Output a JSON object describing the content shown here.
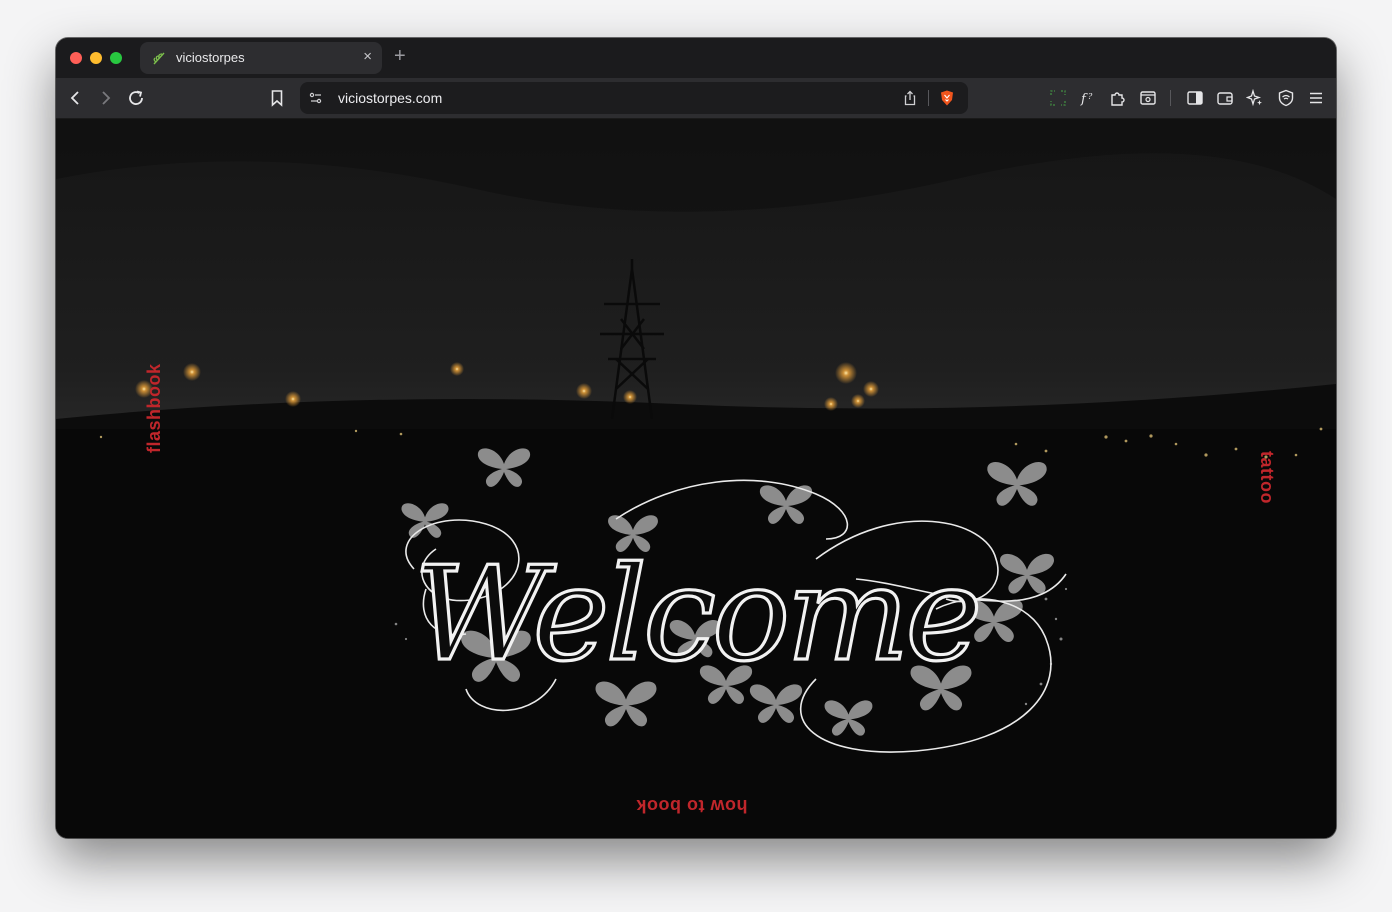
{
  "browser": {
    "tab": {
      "title": "viciostorpes",
      "favicon": "leaf-icon",
      "close": "×"
    },
    "new_tab": "+",
    "url": "viciostorpes.com",
    "toolbar_icons": [
      "back-arrow-icon",
      "forward-arrow-icon",
      "reload-icon",
      "bookmark-icon",
      "site-settings-icon",
      "share-icon",
      "brave-shields-icon",
      "screenshot-icon",
      "font-icon",
      "extensions-icon",
      "reader-mode-icon",
      "sidebar-icon",
      "wallet-icon",
      "leo-ai-icon",
      "vpn-icon",
      "menu-icon"
    ]
  },
  "site": {
    "welcome_text": "Welcome",
    "nav": {
      "left": "flashbook",
      "right": "tattoo",
      "bottom": "how to book"
    }
  },
  "colors": {
    "accent": "#c0262b",
    "sky": "#1b1b1b",
    "ground": "#090909",
    "butterfly": "#8c8c8c",
    "lettering": "#f2f2f2"
  }
}
